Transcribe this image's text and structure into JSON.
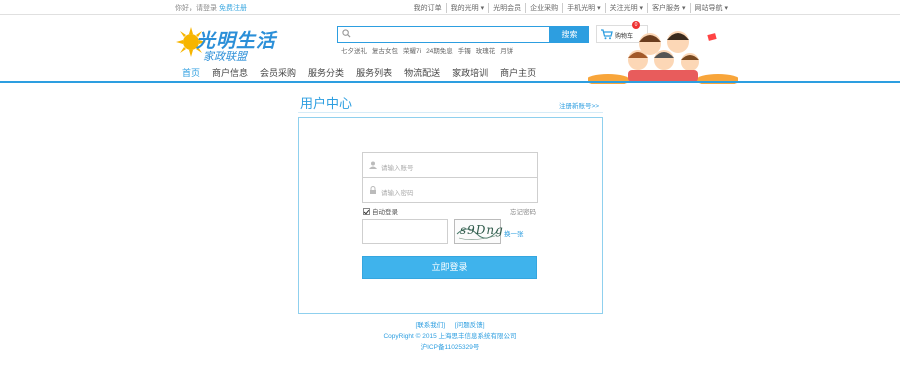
{
  "topbar": {
    "greeting": "你好，请登录",
    "register": "免费注册",
    "links": [
      "我的订单",
      "我的光明 ▾",
      "光明会员",
      "企业采购",
      "手机光明 ▾",
      "关注光明 ▾",
      "客户服务 ▾",
      "网站导航 ▾"
    ]
  },
  "logo": {
    "main": "光明生活",
    "sub": "家政联盟"
  },
  "search": {
    "placeholder": "",
    "button": "搜索"
  },
  "cart": {
    "label": "购物车",
    "count": "0"
  },
  "hot_terms": [
    "七夕送礼",
    "复古女包",
    "荣耀7i",
    "24期免息",
    "手镯",
    "玫瑰花",
    "月饼"
  ],
  "nav": [
    "首页",
    "商户信息",
    "会员采购",
    "服务分类",
    "服务列表",
    "物流配送",
    "家政培训",
    "商户主页"
  ],
  "user_center": {
    "title": "用户中心",
    "register_link": "注册新账号>>",
    "account_placeholder": "请输入账号",
    "password_placeholder": "请输入密码",
    "auto_login": "自动登录",
    "forgot": "忘记密码",
    "captcha_text": "s9Dng",
    "refresh": "换一张",
    "login_button": "立即登录"
  },
  "footer": {
    "links": [
      "[联系我们]",
      "[问题反馈]"
    ],
    "copyright": "CopyRight © 2015 上海思丰信息系统有限公司",
    "icp": "沪ICP备11025329号"
  },
  "colors": {
    "accent": "#2d9ee0",
    "button": "#3fb3ec"
  }
}
